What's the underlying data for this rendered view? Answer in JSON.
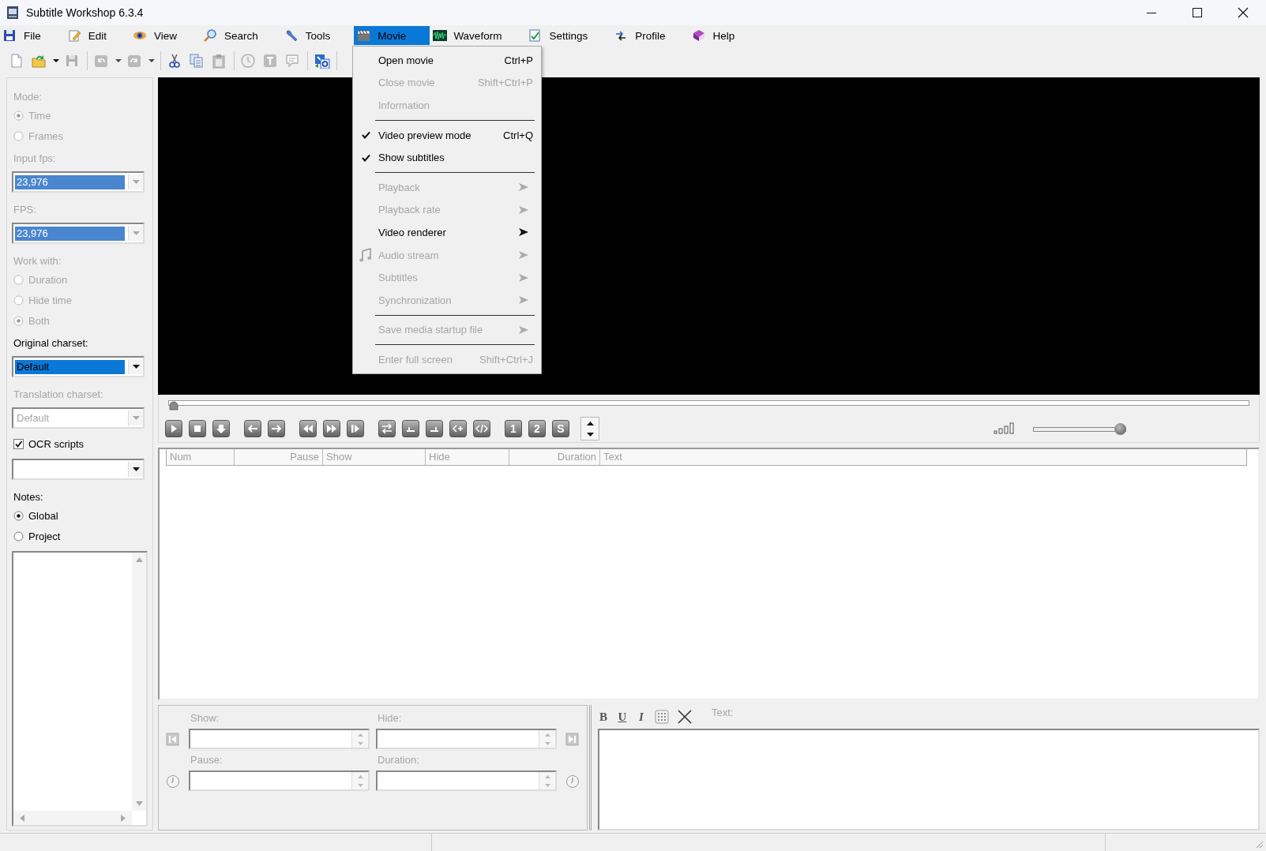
{
  "window": {
    "title": "Subtitle Workshop 6.3.4"
  },
  "menubar": [
    {
      "label": "File",
      "selected": false
    },
    {
      "label": "Edit",
      "selected": false
    },
    {
      "label": "View",
      "selected": false
    },
    {
      "label": "Search",
      "selected": false
    },
    {
      "label": "Tools",
      "selected": false
    },
    {
      "label": "Movie",
      "selected": true
    },
    {
      "label": "Waveform",
      "selected": false
    },
    {
      "label": "Settings",
      "selected": false
    },
    {
      "label": "Profile",
      "selected": false
    },
    {
      "label": "Help",
      "selected": false
    }
  ],
  "toolbar": [
    {
      "kind": "new",
      "disabled": false
    },
    {
      "kind": "open",
      "disabled": false
    },
    {
      "kind": "caret",
      "disabled": false
    },
    {
      "kind": "save",
      "disabled": true
    },
    {
      "kind": "separator"
    },
    {
      "kind": "undo",
      "disabled": true
    },
    {
      "kind": "caret",
      "disabled": true
    },
    {
      "kind": "redo",
      "disabled": true
    },
    {
      "kind": "caret",
      "disabled": true
    },
    {
      "kind": "separator"
    },
    {
      "kind": "cut",
      "disabled": false
    },
    {
      "kind": "copy",
      "disabled": false
    },
    {
      "kind": "paste",
      "disabled": true
    },
    {
      "kind": "separator"
    },
    {
      "kind": "clock",
      "disabled": true
    },
    {
      "kind": "text",
      "disabled": true
    },
    {
      "kind": "bubble",
      "disabled": true
    },
    {
      "kind": "separator"
    },
    {
      "kind": "translate",
      "disabled": false
    },
    {
      "kind": "separator"
    }
  ],
  "movie_menu": [
    {
      "kind": "item",
      "label": "Open movie",
      "shortcut": "Ctrl+P",
      "disabled": false,
      "checked": false,
      "submenu": false
    },
    {
      "kind": "item",
      "label": "Close movie",
      "shortcut": "Shift+Ctrl+P",
      "disabled": true,
      "checked": false,
      "submenu": false
    },
    {
      "kind": "item",
      "label": "Information",
      "disabled": true,
      "checked": false,
      "submenu": false
    },
    {
      "kind": "separator"
    },
    {
      "kind": "item",
      "label": "Video preview mode",
      "shortcut": "Ctrl+Q",
      "disabled": false,
      "checked": true,
      "submenu": false
    },
    {
      "kind": "item",
      "label": "Show subtitles",
      "disabled": false,
      "checked": true,
      "submenu": false
    },
    {
      "kind": "separator"
    },
    {
      "kind": "item",
      "label": "Playback",
      "disabled": true,
      "checked": false,
      "submenu": true
    },
    {
      "kind": "item",
      "label": "Playback rate",
      "disabled": true,
      "checked": false,
      "submenu": true
    },
    {
      "kind": "item",
      "label": "Video renderer",
      "disabled": false,
      "checked": false,
      "submenu": true
    },
    {
      "kind": "icon-item",
      "label": "Audio stream",
      "disabled": true,
      "checked": false,
      "submenu": true
    },
    {
      "kind": "item",
      "label": "Subtitles",
      "disabled": true,
      "checked": false,
      "submenu": true
    },
    {
      "kind": "item",
      "label": "Synchronization",
      "disabled": true,
      "checked": false,
      "submenu": true
    },
    {
      "kind": "separator"
    },
    {
      "kind": "item",
      "label": "Save media startup file",
      "disabled": true,
      "checked": false,
      "submenu": true
    },
    {
      "kind": "separator"
    },
    {
      "kind": "item",
      "label": "Enter full screen",
      "shortcut": "Shift+Ctrl+J",
      "disabled": true,
      "checked": false,
      "submenu": false
    }
  ],
  "left_panel": [
    {
      "kind": "label",
      "text": "Mode:",
      "disabled": true
    },
    {
      "kind": "radio",
      "label": "Time",
      "selected": true,
      "disabled": true
    },
    {
      "kind": "radio",
      "label": "Frames",
      "selected": false,
      "disabled": true
    },
    {
      "kind": "label",
      "text": "Input fps:",
      "disabled": true
    },
    {
      "kind": "combo",
      "value": "23,976",
      "highlighted": true,
      "disabled": true
    },
    {
      "kind": "label",
      "text": "FPS:",
      "disabled": true
    },
    {
      "kind": "combo",
      "value": "23,976",
      "highlighted": true,
      "disabled": true
    },
    {
      "kind": "label",
      "text": "Work with:",
      "disabled": true
    },
    {
      "kind": "radio",
      "label": "Duration",
      "selected": false,
      "disabled": true
    },
    {
      "kind": "radio",
      "label": "Hide time",
      "selected": false,
      "disabled": true
    },
    {
      "kind": "radio",
      "label": "Both",
      "selected": true,
      "disabled": true
    },
    {
      "kind": "label",
      "text": "Original charset:",
      "disabled": false
    },
    {
      "kind": "combo",
      "value": "Default",
      "highlighted": true,
      "disabled": false
    },
    {
      "kind": "label",
      "text": "Translation charset:",
      "disabled": true
    },
    {
      "kind": "combo",
      "value": "Default",
      "highlighted": false,
      "disabled": true
    },
    {
      "kind": "checkbox",
      "label": "OCR scripts",
      "checked": true,
      "disabled": false
    },
    {
      "kind": "combo",
      "disabled": false
    },
    {
      "kind": "label",
      "text": "Notes:",
      "disabled": false
    },
    {
      "kind": "radio",
      "label": "Global",
      "selected": true,
      "disabled": false
    },
    {
      "kind": "radio",
      "label": "Project",
      "selected": false,
      "disabled": false
    },
    {
      "kind": "memo"
    }
  ],
  "seek_bar": {
    "level": 0
  },
  "player_buttons": [
    [
      {
        "kind": "play"
      },
      {
        "kind": "stop"
      },
      {
        "kind": "down"
      }
    ],
    [
      {
        "kind": "left"
      },
      {
        "kind": "right"
      }
    ],
    [
      {
        "kind": "rewind"
      },
      {
        "kind": "forward"
      },
      {
        "kind": "step"
      }
    ],
    [
      {
        "kind": "loop"
      },
      {
        "kind": "start"
      },
      {
        "kind": "end"
      },
      {
        "kind": "add"
      },
      {
        "kind": "code"
      }
    ],
    [
      {
        "kind": "label",
        "label": "1"
      },
      {
        "kind": "label",
        "label": "2"
      },
      {
        "kind": "label",
        "label": "S"
      }
    ]
  ],
  "volume": {
    "level": 1
  },
  "table": {
    "columns": [
      {
        "label": "Num"
      },
      {
        "label": "Pause"
      },
      {
        "label": "Show"
      },
      {
        "label": "Hide"
      },
      {
        "label": "Duration"
      },
      {
        "label": "Text"
      }
    ]
  },
  "editor": {
    "fields": [
      {
        "label": "Show:"
      },
      {
        "label": "Hide:"
      },
      {
        "label": "Pause:"
      },
      {
        "label": "Duration:"
      }
    ],
    "format_buttons": [
      {
        "kind": "bold",
        "label": "B"
      },
      {
        "kind": "underline",
        "label": "U"
      },
      {
        "kind": "italic",
        "label": "I"
      }
    ],
    "text_label": "Text:"
  }
}
